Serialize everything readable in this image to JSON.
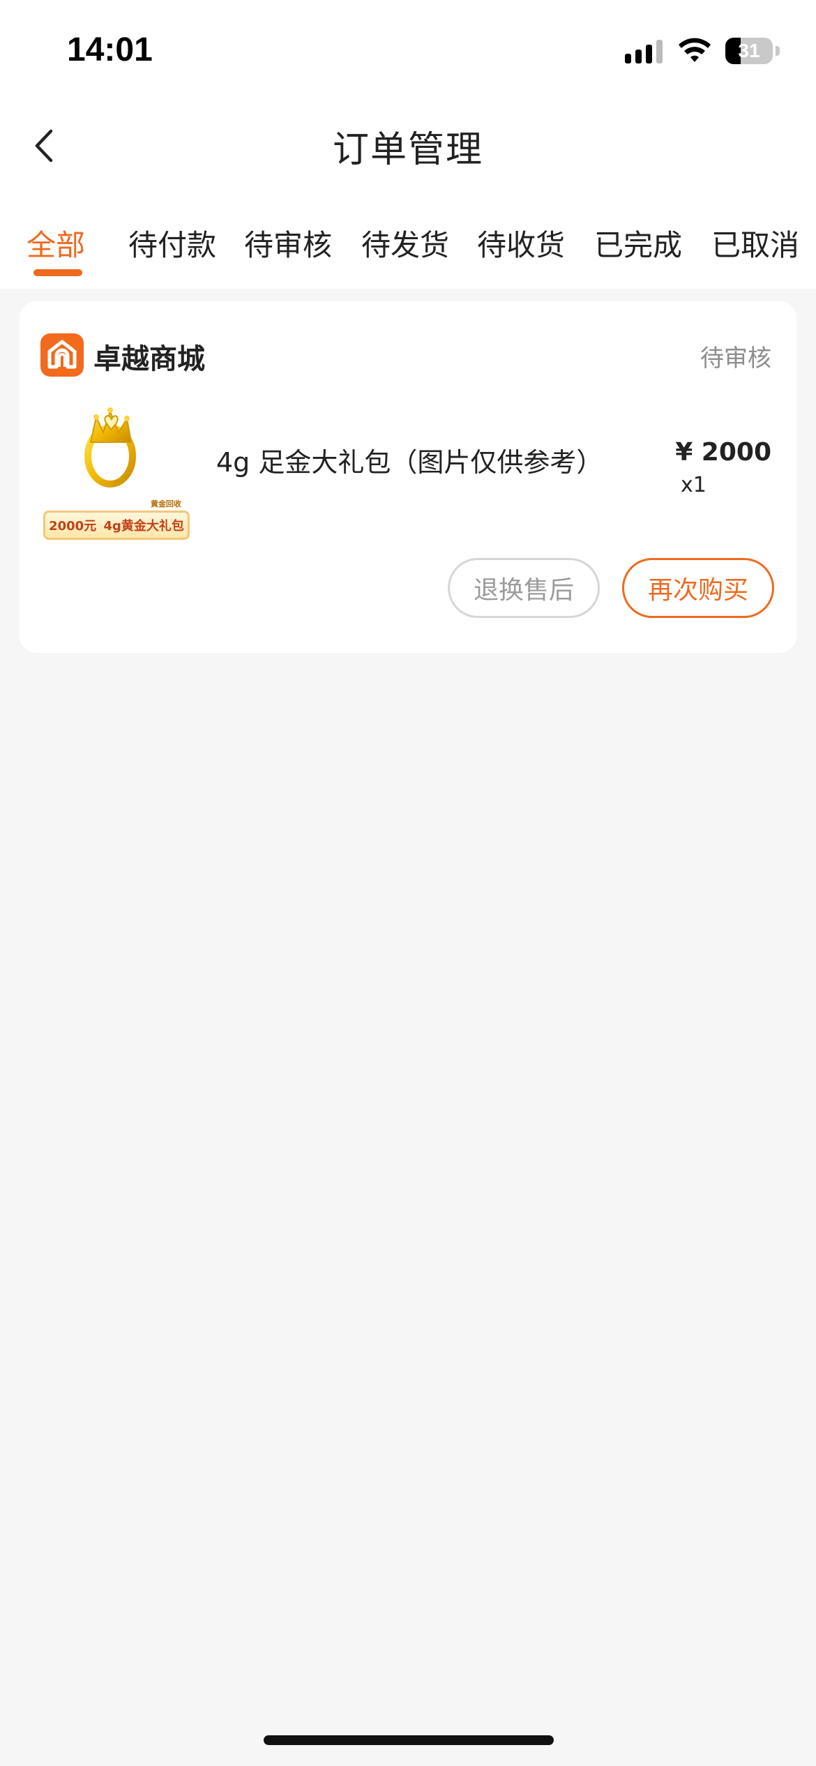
{
  "status_bar": {
    "time": "14:01",
    "battery_level": "31",
    "icons": [
      "signal-icon",
      "wifi-icon",
      "battery-icon"
    ]
  },
  "nav": {
    "title": "订单管理",
    "back_icon": "chevron-left-icon"
  },
  "tabs": [
    {
      "label": "全部",
      "active": true
    },
    {
      "label": "待付款",
      "active": false
    },
    {
      "label": "待审核",
      "active": false
    },
    {
      "label": "待发货",
      "active": false
    },
    {
      "label": "待收货",
      "active": false
    },
    {
      "label": "已完成",
      "active": false
    },
    {
      "label": "已取消",
      "active": false
    }
  ],
  "order": {
    "shop_name": "卓越商城",
    "status": "待审核",
    "product": {
      "name": "4g 足金大礼包（图片仅供参考）",
      "price": "¥ 2000",
      "quantity": "x1",
      "image_tag": "黄金回收",
      "image_banner_left": "2000元",
      "image_banner_right": "4g黄金大礼包"
    },
    "actions": {
      "return_label": "退换售后",
      "rebuy_label": "再次购买"
    }
  },
  "colors": {
    "accent": "#ee6a1e",
    "background": "#f6f6f6",
    "card": "#ffffff",
    "muted_text": "#8d8d8d"
  }
}
